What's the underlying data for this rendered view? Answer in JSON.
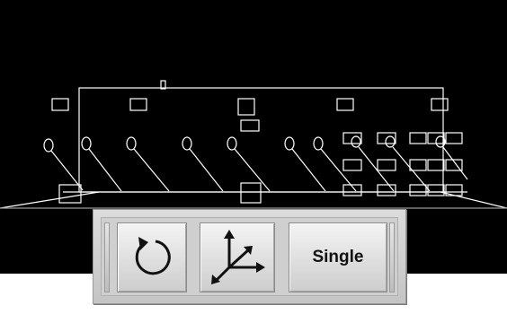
{
  "viewport": {
    "background": "#000000",
    "stroke": "#ffffff"
  },
  "toolbar": {
    "rotate_button": {
      "icon": "rotate-icon"
    },
    "axes_button": {
      "icon": "axes-icon"
    },
    "single_button": {
      "label": "Single"
    }
  }
}
